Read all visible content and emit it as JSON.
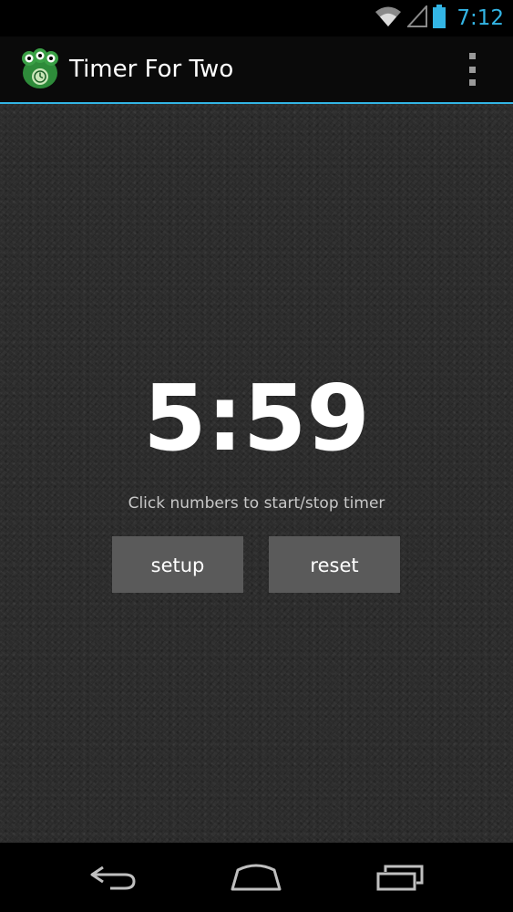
{
  "status_bar": {
    "time": "7:12",
    "icons": [
      "wifi-icon",
      "signal-icon",
      "battery-icon"
    ],
    "accent_color": "#33b5e5"
  },
  "action_bar": {
    "title": "Timer For Two",
    "app_icon": "frog-app-icon",
    "menu_icon": "overflow-menu-icon"
  },
  "main": {
    "timer": "5:59",
    "hint": "Click numbers to start/stop timer",
    "setup_label": "setup",
    "reset_label": "reset"
  },
  "nav_bar": {
    "icons": [
      "back-icon",
      "home-icon",
      "recents-icon"
    ]
  }
}
